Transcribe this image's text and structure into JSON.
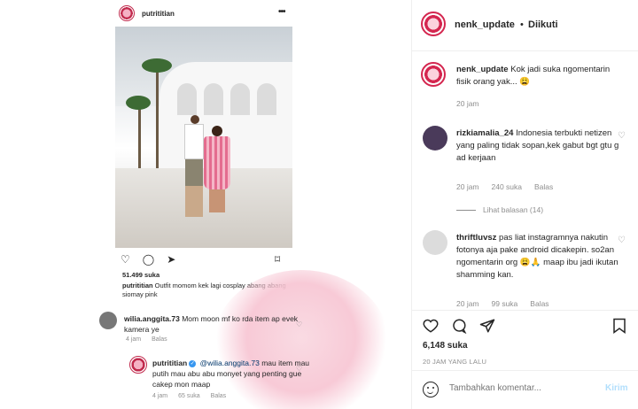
{
  "screenshot": {
    "account": "putrititian",
    "likes": "51.499 suka",
    "caption_user": "putrititian",
    "caption_text": "Outfit momom kek lagi cosplay abang abang siomay pink",
    "comment1": {
      "user": "wilia.anggita.73",
      "text": "Mom moon mf ko rda item ap evek kamera ye",
      "time": "4 jam",
      "reply": "Balas"
    },
    "comment2": {
      "user": "putrititian",
      "mention": "@wilia.anggita.73",
      "text": "mau item mau putih mau abu abu monyet yang penting gue cakep mon maap",
      "time": "4 jam",
      "likes": "65 suka",
      "reply": "Balas"
    }
  },
  "panel": {
    "user": "nenk_update",
    "dot": "•",
    "follow_status": "Diikuti",
    "comments": [
      {
        "user": "nenk_update",
        "text": "Kok jadi suka ngomentarin fisik orang yak... 😩",
        "time": "20 jam"
      },
      {
        "user": "rizkiamalia_24",
        "text": "Indonesia terbukti netizen yang paling tidak sopan,kek gabut bgt gtu g ad kerjaan",
        "time": "20 jam",
        "likes": "240 suka",
        "reply": "Balas"
      },
      {
        "user": "thriftluvsz",
        "text": "pas liat instagramnya nakutin fotonya aja pake android dicakepin. so2an ngomentarin org 😩🙏 maap ibu jadi ikutan shamming kan.",
        "time": "20 jam",
        "likes": "99 suka",
        "reply": "Balas"
      }
    ],
    "view_replies": "Lihat balasan (14)",
    "likes": "6,148 suka",
    "time_ago": "20 JAM YANG LALU",
    "comment_placeholder": "Tambahkan komentar...",
    "send_label": "Kirim"
  }
}
